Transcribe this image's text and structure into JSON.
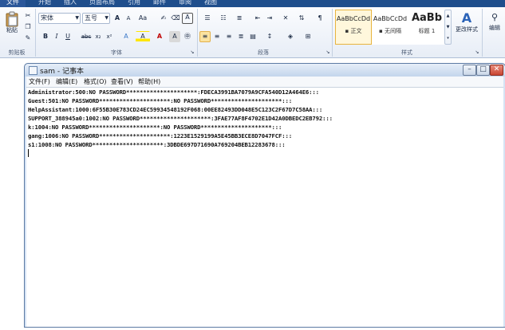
{
  "ribbon": {
    "tabs": [
      "文件",
      "开始",
      "插入",
      "页面布局",
      "引用",
      "邮件",
      "审阅",
      "视图"
    ],
    "clipboard": {
      "paste_label": "粘贴",
      "group_title": "剪贴板"
    },
    "font": {
      "font_name": "宋体",
      "font_size": "五号",
      "grow_label": "A",
      "shrink_label": "A",
      "case_label": "Aa",
      "group_title": "字体",
      "format_buttons": [
        "B",
        "I",
        "U",
        "abc",
        "x₂",
        "x²",
        "A",
        "A",
        "A",
        "A"
      ]
    },
    "paragraph": {
      "group_title": "段落"
    },
    "styles": {
      "items": [
        {
          "sample": "AaBbCcDd",
          "name": "▪ 正文"
        },
        {
          "sample": "AaBbCcDd",
          "name": "▪ 无间隔"
        },
        {
          "sample": "AaBb",
          "name": "标题 1"
        }
      ],
      "change_styles_label": "更改样式",
      "group_title": "样式"
    },
    "editing": {
      "label": "编辑"
    }
  },
  "notepad": {
    "title": "sam - 记事本",
    "menu": [
      "文件(F)",
      "编辑(E)",
      "格式(O)",
      "查看(V)",
      "帮助(H)"
    ],
    "lines": [
      "Administrator:500:NO PASSWORD*********************:FDECA3991BA7079A9CFA540D12A464E6:::",
      "Guest:501:NO PASSWORD*********************:NO PASSWORD*********************:::",
      "HelpAssistant:1000:6F55B30E783CD24EC59934548192F068:00EE82493DD048E5C123C2F67D7C58AA:::",
      "SUPPORT_388945a0:1002:NO PASSWORD*********************:3FAE77AF8F4702E1D42A0DBEDC2EB792:::",
      "k:1004:NO PASSWORD*********************:NO PASSWORD*********************:::",
      "gang:1006:NO PASSWORD*********************:1223E1529199A5E45BB3ECE8D7047FCF:::",
      "s1:1008:NO PASSWORD*********************:3DBDE697D71690A769204BEB12283678:::"
    ]
  },
  "colors": {
    "ribbon_tab_bar": "#1f4e8c",
    "selected_style_border": "#e8b43e",
    "close_button": "#c84431"
  }
}
